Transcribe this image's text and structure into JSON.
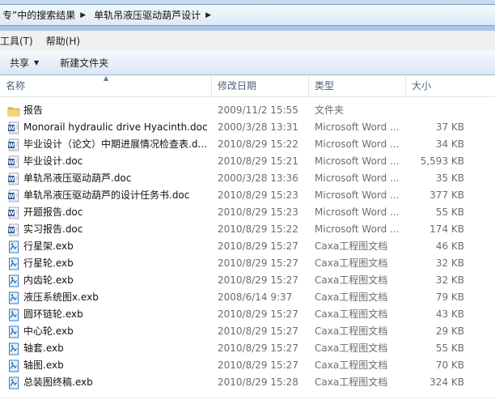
{
  "address": {
    "crumbs": [
      "专”中的搜索结果",
      "单轨吊液压驱动葫芦设计"
    ]
  },
  "menu": {
    "items": [
      "工具(T)",
      "帮助(H)"
    ]
  },
  "toolbar": {
    "share_label": "共享",
    "new_folder_label": "新建文件夹"
  },
  "columns": {
    "name": "名称",
    "date": "修改日期",
    "type": "类型",
    "size": "大小"
  },
  "icons": {
    "folder": "folder-icon",
    "word": "word-doc-icon",
    "exb": "caxa-exb-icon"
  },
  "colors": {
    "folder": "#e9c14a",
    "word": "#2b5797",
    "exb": "#1f6fc0"
  },
  "files": [
    {
      "icon": "folder",
      "name": "报告",
      "date": "2009/11/2 15:55",
      "type": "文件夹",
      "size": ""
    },
    {
      "icon": "word",
      "name": "Monorail hydraulic drive Hyacinth.doc",
      "date": "2000/3/28 13:31",
      "type": "Microsoft Word ...",
      "size": "37 KB"
    },
    {
      "icon": "word",
      "name": "毕业设计（论文）中期进展情况检查表.d...",
      "date": "2010/8/29 15:22",
      "type": "Microsoft Word ...",
      "size": "34 KB"
    },
    {
      "icon": "word",
      "name": "毕业设计.doc",
      "date": "2010/8/29 15:21",
      "type": "Microsoft Word ...",
      "size": "5,593 KB"
    },
    {
      "icon": "word",
      "name": "单轨吊液压驱动葫芦.doc",
      "date": "2000/3/28 13:36",
      "type": "Microsoft Word ...",
      "size": "35 KB"
    },
    {
      "icon": "word",
      "name": "单轨吊液压驱动葫芦的设计任务书.doc",
      "date": "2010/8/29 15:23",
      "type": "Microsoft Word ...",
      "size": "377 KB"
    },
    {
      "icon": "word",
      "name": "开题报告.doc",
      "date": "2010/8/29 15:23",
      "type": "Microsoft Word ...",
      "size": "55 KB"
    },
    {
      "icon": "word",
      "name": "实习报告.doc",
      "date": "2010/8/29 15:22",
      "type": "Microsoft Word ...",
      "size": "174 KB"
    },
    {
      "icon": "exb",
      "name": "行星架.exb",
      "date": "2010/8/29 15:27",
      "type": "Caxa工程图文档",
      "size": "46 KB"
    },
    {
      "icon": "exb",
      "name": "行星轮.exb",
      "date": "2010/8/29 15:27",
      "type": "Caxa工程图文档",
      "size": "32 KB"
    },
    {
      "icon": "exb",
      "name": "内齿轮.exb",
      "date": "2010/8/29 15:27",
      "type": "Caxa工程图文档",
      "size": "32 KB"
    },
    {
      "icon": "exb",
      "name": "液压系统图x.exb",
      "date": "2008/6/14 9:37",
      "type": "Caxa工程图文档",
      "size": "79 KB"
    },
    {
      "icon": "exb",
      "name": "圆环链轮.exb",
      "date": "2010/8/29 15:27",
      "type": "Caxa工程图文档",
      "size": "43 KB"
    },
    {
      "icon": "exb",
      "name": "中心轮.exb",
      "date": "2010/8/29 15:27",
      "type": "Caxa工程图文档",
      "size": "29 KB"
    },
    {
      "icon": "exb",
      "name": "轴套.exb",
      "date": "2010/8/29 15:27",
      "type": "Caxa工程图文档",
      "size": "55 KB"
    },
    {
      "icon": "exb",
      "name": "轴图.exb",
      "date": "2010/8/29 15:27",
      "type": "Caxa工程图文档",
      "size": "70 KB"
    },
    {
      "icon": "exb",
      "name": "总装图终稿.exb",
      "date": "2010/8/29 15:28",
      "type": "Caxa工程图文档",
      "size": "324 KB"
    }
  ]
}
